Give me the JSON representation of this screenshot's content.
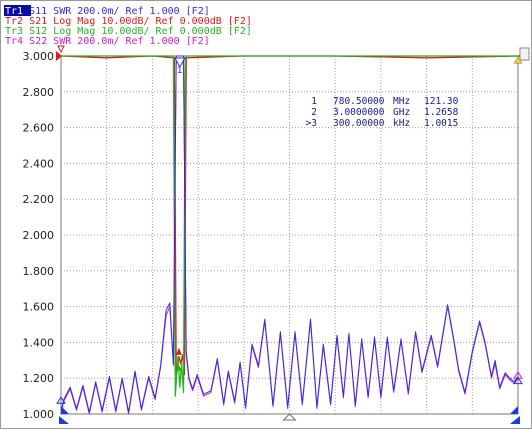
{
  "colors": {
    "tr1": "#2e2ee0",
    "tr2": "#d81c1c",
    "tr3": "#22b822",
    "tr4": "#d21cd2",
    "grid": "#9c9c9c",
    "marker_text": "#1a1a8c",
    "axis_text": "#1e1e1e"
  },
  "traces": [
    {
      "id": "Tr1",
      "label": "Tr1",
      "param": "S11",
      "format": "SWR",
      "scale": "200.0m/",
      "ref": "Ref 1.000",
      "port": "[F2]",
      "active": true
    },
    {
      "id": "Tr2",
      "label": "Tr2",
      "param": "S21",
      "format": "Log Mag",
      "scale": "10.00dB/",
      "ref": "Ref 0.000dB",
      "port": "[F2]",
      "active": false
    },
    {
      "id": "Tr3",
      "label": "Tr3",
      "param": "S12",
      "format": "Log Mag",
      "scale": "10.00dB/",
      "ref": "Ref 0.000dB",
      "port": "[F2]",
      "active": false
    },
    {
      "id": "Tr4",
      "label": "Tr4",
      "param": "S22",
      "format": "SWR",
      "scale": "200.0m/",
      "ref": "Ref 1.000",
      "port": "[F2]",
      "active": false
    }
  ],
  "markers": [
    {
      "prefix": "",
      "num": "1",
      "freq": "780.50000",
      "unit": "MHz",
      "value": "121.30"
    },
    {
      "prefix": "",
      "num": "2",
      "freq": "3.0000000",
      "unit": "GHz",
      "value": "1.2658"
    },
    {
      "prefix": ">",
      "num": "3",
      "freq": "300.00000",
      "unit": "kHz",
      "value": "1.0015"
    }
  ],
  "chart_data": {
    "type": "line",
    "ylim": [
      1.0,
      3.0
    ],
    "y_ticks": [
      "3.000",
      "2.800",
      "2.600",
      "2.400",
      "2.200",
      "2.000",
      "1.800",
      "1.600",
      "1.400",
      "1.200",
      "1.000"
    ],
    "grid": true,
    "x_divisions": 10,
    "series": [
      {
        "name": "Tr1",
        "values": [
          [
            0.0,
            1.01
          ],
          [
            0.3,
            1.08
          ],
          [
            1.0,
            1.15
          ],
          [
            1.7,
            1.03
          ],
          [
            2.4,
            1.16
          ],
          [
            3.1,
            1.01
          ],
          [
            3.8,
            1.18
          ],
          [
            4.5,
            1.02
          ],
          [
            5.3,
            1.21
          ],
          [
            6.0,
            1.02
          ],
          [
            6.7,
            1.2
          ],
          [
            7.4,
            1.01
          ],
          [
            8.1,
            1.24
          ],
          [
            8.8,
            1.03
          ],
          [
            9.6,
            1.21
          ],
          [
            10.3,
            1.09
          ],
          [
            10.9,
            1.27
          ],
          [
            11.5,
            1.58
          ],
          [
            11.9,
            1.62
          ],
          [
            12.3,
            1.28
          ],
          [
            12.6,
            3.0
          ],
          [
            13.0,
            3.0
          ],
          [
            13.4,
            3.0
          ],
          [
            13.7,
            1.35
          ],
          [
            14.0,
            1.2
          ],
          [
            14.4,
            1.14
          ],
          [
            14.9,
            1.22
          ],
          [
            15.6,
            1.11
          ],
          [
            16.4,
            1.13
          ],
          [
            17.1,
            1.31
          ],
          [
            17.8,
            1.06
          ],
          [
            18.3,
            1.24
          ],
          [
            19.0,
            1.07
          ],
          [
            19.6,
            1.29
          ],
          [
            20.2,
            1.04
          ],
          [
            20.9,
            1.39
          ],
          [
            21.6,
            1.27
          ],
          [
            22.3,
            1.53
          ],
          [
            23.2,
            1.05
          ],
          [
            24.0,
            1.46
          ],
          [
            24.8,
            1.04
          ],
          [
            25.6,
            1.46
          ],
          [
            26.4,
            1.06
          ],
          [
            27.3,
            1.53
          ],
          [
            28.0,
            1.04
          ],
          [
            28.7,
            1.39
          ],
          [
            29.5,
            1.06
          ],
          [
            30.2,
            1.44
          ],
          [
            30.9,
            1.1
          ],
          [
            31.5,
            1.45
          ],
          [
            32.2,
            1.05
          ],
          [
            32.9,
            1.42
          ],
          [
            33.6,
            1.1
          ],
          [
            34.3,
            1.43
          ],
          [
            35.0,
            1.1
          ],
          [
            35.7,
            1.43
          ],
          [
            36.4,
            1.13
          ],
          [
            37.2,
            1.42
          ],
          [
            38.0,
            1.12
          ],
          [
            38.8,
            1.46
          ],
          [
            39.5,
            1.24
          ],
          [
            40.5,
            1.44
          ],
          [
            41.2,
            1.27
          ],
          [
            42.3,
            1.61
          ],
          [
            43.0,
            1.41
          ],
          [
            43.5,
            1.25
          ],
          [
            44.2,
            1.12
          ],
          [
            45.0,
            1.35
          ],
          [
            45.8,
            1.52
          ],
          [
            46.4,
            1.4
          ],
          [
            47.1,
            1.21
          ],
          [
            47.5,
            1.3
          ],
          [
            48.0,
            1.15
          ],
          [
            48.6,
            1.23
          ],
          [
            49.1,
            1.2
          ],
          [
            49.6,
            1.18
          ],
          [
            50.0,
            1.21
          ]
        ]
      },
      {
        "name": "Tr2",
        "values": [
          [
            0.0,
            3.0
          ],
          [
            5.0,
            2.99
          ],
          [
            10.0,
            3.0
          ],
          [
            12.4,
            2.99
          ],
          [
            12.6,
            1.22
          ],
          [
            12.9,
            1.32
          ],
          [
            13.1,
            1.28
          ],
          [
            13.3,
            1.33
          ],
          [
            13.5,
            1.22
          ],
          [
            13.7,
            2.99
          ],
          [
            20.0,
            3.0
          ],
          [
            30.0,
            3.0
          ],
          [
            40.0,
            2.99
          ],
          [
            50.0,
            3.0
          ]
        ]
      },
      {
        "name": "Tr3",
        "values": [
          [
            0.0,
            3.0
          ],
          [
            5.0,
            3.0
          ],
          [
            12.3,
            3.0
          ],
          [
            12.5,
            1.1
          ],
          [
            12.8,
            1.32
          ],
          [
            13.0,
            1.15
          ],
          [
            13.2,
            1.28
          ],
          [
            13.4,
            1.12
          ],
          [
            13.6,
            3.0
          ],
          [
            50.0,
            3.0
          ]
        ]
      },
      {
        "name": "Tr4",
        "values": [
          [
            0.0,
            1.0
          ],
          [
            0.3,
            1.07
          ],
          [
            1.0,
            1.14
          ],
          [
            1.7,
            1.02
          ],
          [
            2.4,
            1.15
          ],
          [
            3.1,
            1.0
          ],
          [
            3.8,
            1.17
          ],
          [
            4.5,
            1.01
          ],
          [
            5.3,
            1.2
          ],
          [
            6.0,
            1.01
          ],
          [
            6.7,
            1.19
          ],
          [
            7.4,
            1.0
          ],
          [
            8.1,
            1.23
          ],
          [
            8.8,
            1.02
          ],
          [
            9.6,
            1.2
          ],
          [
            10.3,
            1.08
          ],
          [
            10.9,
            1.26
          ],
          [
            11.5,
            1.55
          ],
          [
            11.9,
            1.6
          ],
          [
            12.3,
            1.27
          ],
          [
            12.6,
            3.0
          ],
          [
            13.0,
            3.0
          ],
          [
            13.4,
            3.0
          ],
          [
            13.7,
            1.33
          ],
          [
            14.0,
            1.19
          ],
          [
            14.4,
            1.13
          ],
          [
            14.9,
            1.21
          ],
          [
            15.6,
            1.1
          ],
          [
            16.4,
            1.12
          ],
          [
            17.1,
            1.3
          ],
          [
            17.8,
            1.05
          ],
          [
            18.3,
            1.23
          ],
          [
            19.0,
            1.06
          ],
          [
            19.6,
            1.28
          ],
          [
            20.2,
            1.03
          ],
          [
            20.9,
            1.38
          ],
          [
            21.6,
            1.26
          ],
          [
            22.3,
            1.52
          ],
          [
            23.2,
            1.04
          ],
          [
            24.0,
            1.45
          ],
          [
            24.8,
            1.03
          ],
          [
            25.6,
            1.45
          ],
          [
            26.4,
            1.05
          ],
          [
            27.3,
            1.52
          ],
          [
            28.0,
            1.03
          ],
          [
            28.7,
            1.38
          ],
          [
            29.5,
            1.05
          ],
          [
            30.2,
            1.43
          ],
          [
            30.9,
            1.09
          ],
          [
            31.5,
            1.44
          ],
          [
            32.2,
            1.04
          ],
          [
            32.9,
            1.41
          ],
          [
            33.6,
            1.09
          ],
          [
            34.3,
            1.42
          ],
          [
            35.0,
            1.09
          ],
          [
            35.7,
            1.42
          ],
          [
            36.4,
            1.12
          ],
          [
            37.2,
            1.41
          ],
          [
            38.0,
            1.11
          ],
          [
            38.8,
            1.45
          ],
          [
            39.5,
            1.23
          ],
          [
            40.5,
            1.43
          ],
          [
            41.2,
            1.26
          ],
          [
            42.3,
            1.6
          ],
          [
            43.0,
            1.4
          ],
          [
            43.5,
            1.24
          ],
          [
            44.2,
            1.11
          ],
          [
            45.0,
            1.34
          ],
          [
            45.8,
            1.51
          ],
          [
            46.4,
            1.39
          ],
          [
            47.1,
            1.2
          ],
          [
            47.5,
            1.28
          ],
          [
            48.0,
            1.14
          ],
          [
            48.6,
            1.22
          ],
          [
            49.1,
            1.19
          ],
          [
            49.6,
            1.17
          ],
          [
            50.0,
            1.2
          ]
        ]
      }
    ]
  }
}
